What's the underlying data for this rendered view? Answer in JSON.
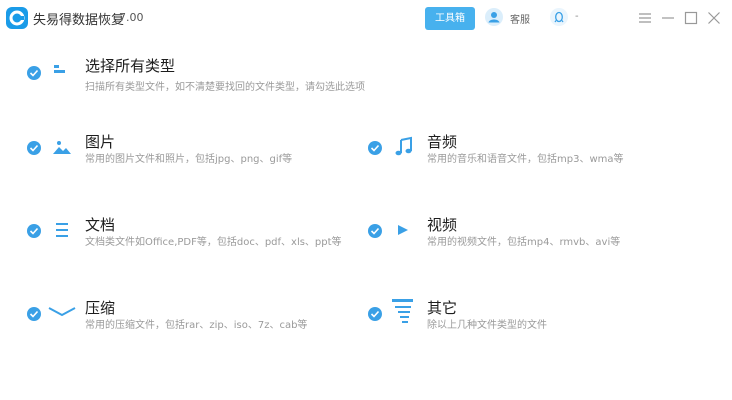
{
  "app": {
    "name": "失易得数据恢复",
    "version": "7.00"
  },
  "header": {
    "toolbox_label": "工具箱",
    "service_label": "客服",
    "qq_label": "-"
  },
  "categories": [
    {
      "title": "选择所有类型",
      "description": "扫描所有类型文件，如不清楚要找回的文件类型，请勾选此选项",
      "icon": "all-types-icon",
      "checked": true
    },
    {
      "title": "图片",
      "description": "常用的图片文件和照片，包括jpg、png、gif等",
      "icon": "image-icon",
      "checked": true
    },
    {
      "title": "音频",
      "description": "常用的音乐和语音文件，包括mp3、wma等",
      "icon": "music-icon",
      "checked": true
    },
    {
      "title": "文档",
      "description": "文档类文件如Office,PDF等，包括doc、pdf、xls、ppt等",
      "icon": "document-icon",
      "checked": true
    },
    {
      "title": "视频",
      "description": "常用的视频文件，包括mp4、rmvb、avi等",
      "icon": "video-icon",
      "checked": true
    },
    {
      "title": "压缩",
      "description": "常用的压缩文件，包括rar、zip、iso、7z、cab等",
      "icon": "archive-icon",
      "checked": true
    },
    {
      "title": "其它",
      "description": "除以上几种文件类型的文件",
      "icon": "other-icon",
      "checked": true
    }
  ],
  "colors": {
    "accent": "#3aa0e6",
    "button": "#47b1ee"
  }
}
